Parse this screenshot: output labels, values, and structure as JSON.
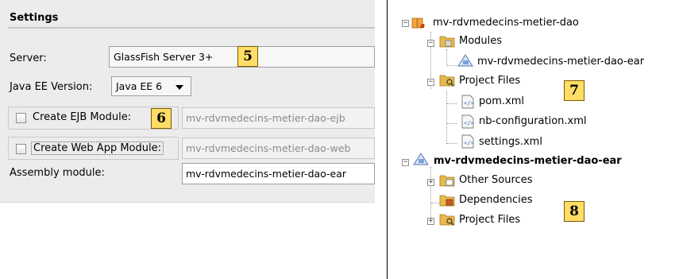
{
  "settings": {
    "header": "Settings",
    "server": {
      "label": "Server:",
      "value": "GlassFish Server 3+"
    },
    "javaee": {
      "label": "Java EE Version:",
      "value": "Java EE 6"
    },
    "ejb": {
      "label": "Create EJB Module:",
      "value": "mv-rdvmedecins-metier-dao-ejb",
      "checked": false
    },
    "web": {
      "label": "Create Web App Module:",
      "value": "mv-rdvmedecins-metier-dao-web",
      "checked": false
    },
    "assembly": {
      "label": "Assembly module:",
      "value": "mv-rdvmedecins-metier-dao-ear"
    }
  },
  "badges": [
    "5",
    "6",
    "7",
    "8"
  ],
  "tree": {
    "root1": "mv-rdvmedecins-metier-dao",
    "modules": "Modules",
    "modules_child": "mv-rdvmedecins-metier-dao-ear",
    "project_files": "Project Files",
    "pom": "pom.xml",
    "nbconfig": "nb-configuration.xml",
    "settings_xml": "settings.xml",
    "root2": "mv-rdvmedecins-metier-dao-ear",
    "other_sources": "Other Sources",
    "dependencies": "Dependencies",
    "project_files2": "Project Files"
  },
  "colors": {
    "badge": "#ffdd66",
    "folder": "#e8b94a",
    "panel": "#ececec"
  },
  "icons": [
    "maven-project-icon",
    "folder-icon",
    "ear-module-icon",
    "project-files-folder-icon",
    "xml-file-icon",
    "dependencies-folder-icon",
    "expand-icon",
    "collapse-icon"
  ]
}
